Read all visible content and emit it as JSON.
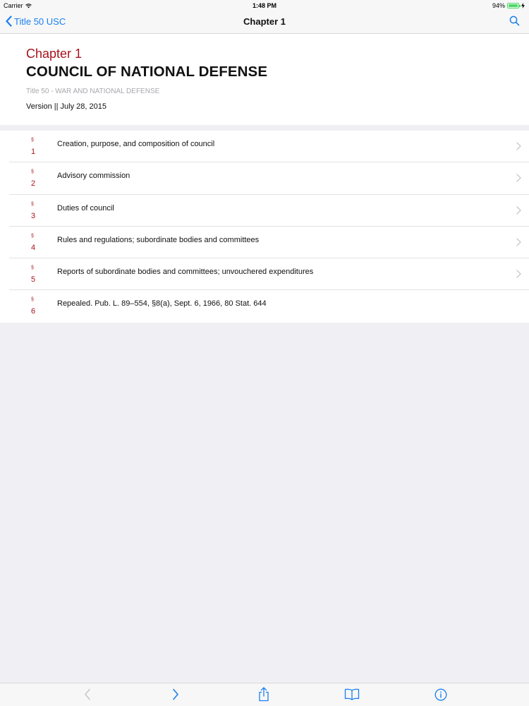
{
  "status_bar": {
    "carrier": "Carrier",
    "time": "1:48 PM",
    "battery": "94%"
  },
  "nav": {
    "back_label": "Title 50 USC",
    "title": "Chapter 1"
  },
  "header": {
    "chapter_label": "Chapter 1",
    "chapter_name": "COUNCIL OF NATIONAL DEFENSE",
    "title_line": "Title 50 - WAR AND NATIONAL DEFENSE",
    "version_line": "Version || July 28, 2015"
  },
  "sections": [
    {
      "symbol": "§",
      "number": "1",
      "title": "Creation, purpose, and composition of council",
      "has_chevron": true
    },
    {
      "symbol": "§",
      "number": "2",
      "title": "Advisory commission",
      "has_chevron": true
    },
    {
      "symbol": "§",
      "number": "3",
      "title": "Duties of council",
      "has_chevron": true
    },
    {
      "symbol": "§",
      "number": "4",
      "title": "Rules and regulations; subordinate bodies and committees",
      "has_chevron": true
    },
    {
      "symbol": "§",
      "number": "5",
      "title": "Reports of subordinate bodies and committees; unvouchered expenditures",
      "has_chevron": true
    },
    {
      "symbol": "§",
      "number": "6",
      "title": "Repealed. Pub. L. 89–554, §8(a), Sept. 6, 1966, 80 Stat. 644",
      "has_chevron": false
    }
  ],
  "toolbar": {
    "icons": [
      "back-arrow-icon",
      "forward-arrow-icon",
      "share-icon",
      "book-icon",
      "info-icon"
    ]
  },
  "colors": {
    "accent": "#1a7ff0",
    "chapter_red": "#a8131d",
    "background": "#efeff4",
    "battery_green": "#4cd964"
  }
}
